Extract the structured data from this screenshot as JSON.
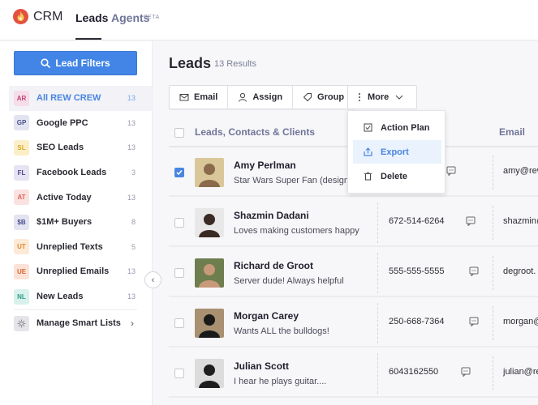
{
  "topbar": {
    "brand": "CRM",
    "nav": [
      {
        "label": "Leads",
        "active": true
      },
      {
        "label": "Agents",
        "tag": "BETA",
        "active": false
      }
    ]
  },
  "sidebar": {
    "filter_button": "Lead Filters",
    "items": [
      {
        "badge": "AR",
        "label": "All REW CREW",
        "count": "13",
        "active": true,
        "badge_bg": "#f6dde8",
        "badge_fg": "#c2437a"
      },
      {
        "badge": "GP",
        "label": "Google PPC",
        "count": "13",
        "badge_bg": "#e3e4f1",
        "badge_fg": "#45508a"
      },
      {
        "badge": "SL",
        "label": "SEO Leads",
        "count": "13",
        "badge_bg": "#fbefc8",
        "badge_fg": "#e0a72a"
      },
      {
        "badge": "FL",
        "label": "Facebook Leads",
        "count": "3",
        "badge_bg": "#e6e3f3",
        "badge_fg": "#4e4590"
      },
      {
        "badge": "AT",
        "label": "Active Today",
        "count": "13",
        "badge_bg": "#fbe1e0",
        "badge_fg": "#e0625a"
      },
      {
        "badge": "$B",
        "label": "$1M+ Buyers",
        "count": "8",
        "badge_bg": "#e3e3f1",
        "badge_fg": "#4a4d8c"
      },
      {
        "badge": "UT",
        "label": "Unreplied Texts",
        "count": "5",
        "badge_bg": "#fce9d6",
        "badge_fg": "#e08a38"
      },
      {
        "badge": "UE",
        "label": "Unreplied Emails",
        "count": "13",
        "badge_bg": "#fbe2d6",
        "badge_fg": "#d9652f"
      },
      {
        "badge": "NL",
        "label": "New Leads",
        "count": "13",
        "badge_bg": "#d8f1ec",
        "badge_fg": "#2f9c87"
      }
    ],
    "manage": "Manage Smart Lists"
  },
  "main": {
    "title": "Leads",
    "results": "13 Results",
    "toolbar": {
      "email": "Email",
      "assign": "Assign",
      "group": "Group",
      "more": "More"
    },
    "dropdown": [
      {
        "label": "Action Plan",
        "icon": "checkbox-icon"
      },
      {
        "label": "Export",
        "icon": "export-icon",
        "highlighted": true
      },
      {
        "label": "Delete",
        "icon": "trash-icon"
      }
    ],
    "columns": {
      "leads": "Leads, Contacts & Clients",
      "email": "Email"
    },
    "rows": [
      {
        "name": "Amy Perlman",
        "note": "Star Wars Super Fan (designer)",
        "phone": "",
        "email": "amy@rew",
        "checked": true
      },
      {
        "name": "Shazmin Dadani",
        "note": "Loves making customers happy",
        "phone": "672-514-6264",
        "email": "shazmin@"
      },
      {
        "name": "Richard de Groot",
        "note": "Server dude! Always helpful",
        "phone": "555-555-5555",
        "email": "degroot."
      },
      {
        "name": "Morgan Carey",
        "note": "Wants ALL the bulldogs!",
        "phone": "250-668-7364",
        "email": "morgan@"
      },
      {
        "name": "Julian Scott",
        "note": "I hear he plays guitar....",
        "phone": "6043162550",
        "email": "julian@re"
      }
    ]
  }
}
